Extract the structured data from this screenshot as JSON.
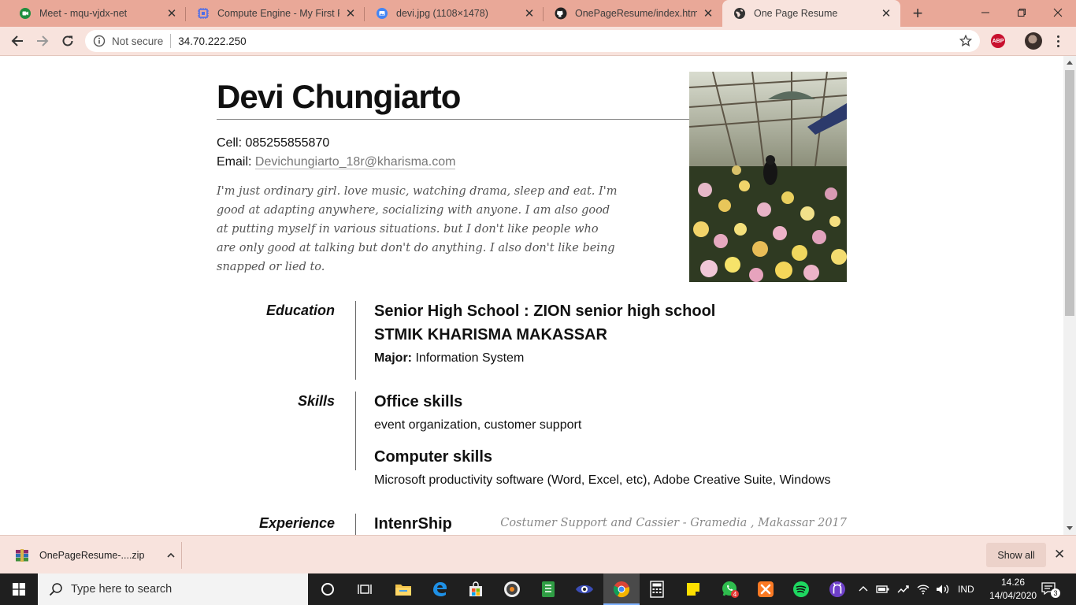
{
  "browser": {
    "tabs": [
      {
        "title": "Meet - mqu-vjdx-net",
        "icon": "google-meet-icon",
        "active": false
      },
      {
        "title": "Compute Engine - My First Pro",
        "icon": "compute-engine-icon",
        "active": false
      },
      {
        "title": "devi.jpg (1108×1478)",
        "icon": "image-tab-icon",
        "active": false
      },
      {
        "title": "OnePageResume/index.html at",
        "icon": "github-icon",
        "active": false
      },
      {
        "title": "One Page Resume",
        "icon": "globe-icon",
        "active": true
      }
    ],
    "security_label": "Not secure",
    "url": "34.70.222.250",
    "extension_label": "ABP"
  },
  "resume": {
    "name": "Devi Chungiarto",
    "cell_label": "Cell:",
    "cell": "085255855870",
    "email_label": "Email:",
    "email": "Devichungiarto_18r@kharisma.com",
    "bio": "I'm just ordinary girl. love music, watching drama, sleep and eat. I'm good at adapting anywhere, socializing with anyone. I am also good at putting myself in various situations. but I don't like people who are only good at talking but don't do anything. I also don't like being snapped or lied to.",
    "education": {
      "label": "Education",
      "school": "Senior High School : ZION senior high school",
      "college": "STMIK KHARISMA MAKASSAR",
      "major_label": "Major:",
      "major": "Information System"
    },
    "skills": {
      "label": "Skills",
      "groups": [
        {
          "title": "Office skills",
          "detail": "event organization, customer support"
        },
        {
          "title": "Computer skills",
          "detail": "Microsoft productivity software (Word, Excel, etc), Adobe Creative Suite, Windows"
        }
      ]
    },
    "experience": {
      "label": "Experience",
      "title": "IntenrShip",
      "meta": "Costumer Support and Cassier - Gramedia , Makassar 2017"
    }
  },
  "download_bar": {
    "filename": "OnePageResume-....zip",
    "show_all_label": "Show all"
  },
  "taskbar": {
    "search_placeholder": "Type here to search",
    "whatsapp_badge": "4",
    "language": "IND",
    "time": "14.26",
    "date": "14/04/2020",
    "notification_count": "3"
  },
  "colors": {
    "titlebar": "#e9a898",
    "toolbar": "#f8e3dd",
    "taskbar": "#1f1f1f"
  }
}
